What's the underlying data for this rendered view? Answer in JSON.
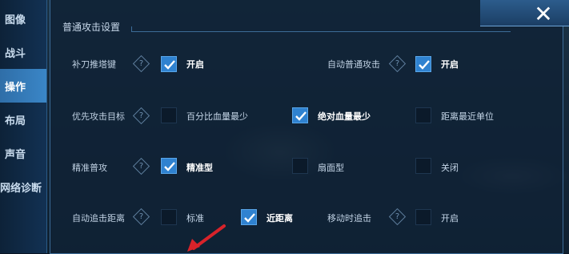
{
  "sidebar": {
    "items": [
      {
        "label": "图像",
        "active": false
      },
      {
        "label": "战斗",
        "active": false
      },
      {
        "label": "操作",
        "active": true
      },
      {
        "label": "布局",
        "active": false
      },
      {
        "label": "声音",
        "active": false
      },
      {
        "label": "网络诊断",
        "active": false
      }
    ]
  },
  "section": {
    "title": "普通攻击设置"
  },
  "close": {
    "symbol": "✕"
  },
  "rows": {
    "r1": {
      "a": {
        "label": "补刀推塔键",
        "option": "开启",
        "checked": true
      },
      "b": {
        "label": "自动普通攻击",
        "option": "开启",
        "checked": true
      }
    },
    "r2": {
      "label": "优先攻击目标",
      "options": [
        {
          "label": "百分比血量最少",
          "checked": false
        },
        {
          "label": "绝对血量最少",
          "checked": true
        },
        {
          "label": "距离最近单位",
          "checked": false
        }
      ]
    },
    "r3": {
      "label": "精准普攻",
      "options": [
        {
          "label": "精准型",
          "checked": true
        },
        {
          "label": "扇面型",
          "checked": false
        },
        {
          "label": "关闭",
          "checked": false
        }
      ]
    },
    "r4": {
      "a": {
        "label": "自动追击距离",
        "options": [
          {
            "label": "标准",
            "checked": false
          },
          {
            "label": "近距离",
            "checked": true
          }
        ]
      },
      "b": {
        "label": "移动时追击",
        "option": "开启",
        "checked": false
      }
    }
  },
  "colors": {
    "accent": "#2f82d0",
    "active_tab": "#3a86c7",
    "arrow": "#d8232a"
  },
  "help_glyph": "?"
}
